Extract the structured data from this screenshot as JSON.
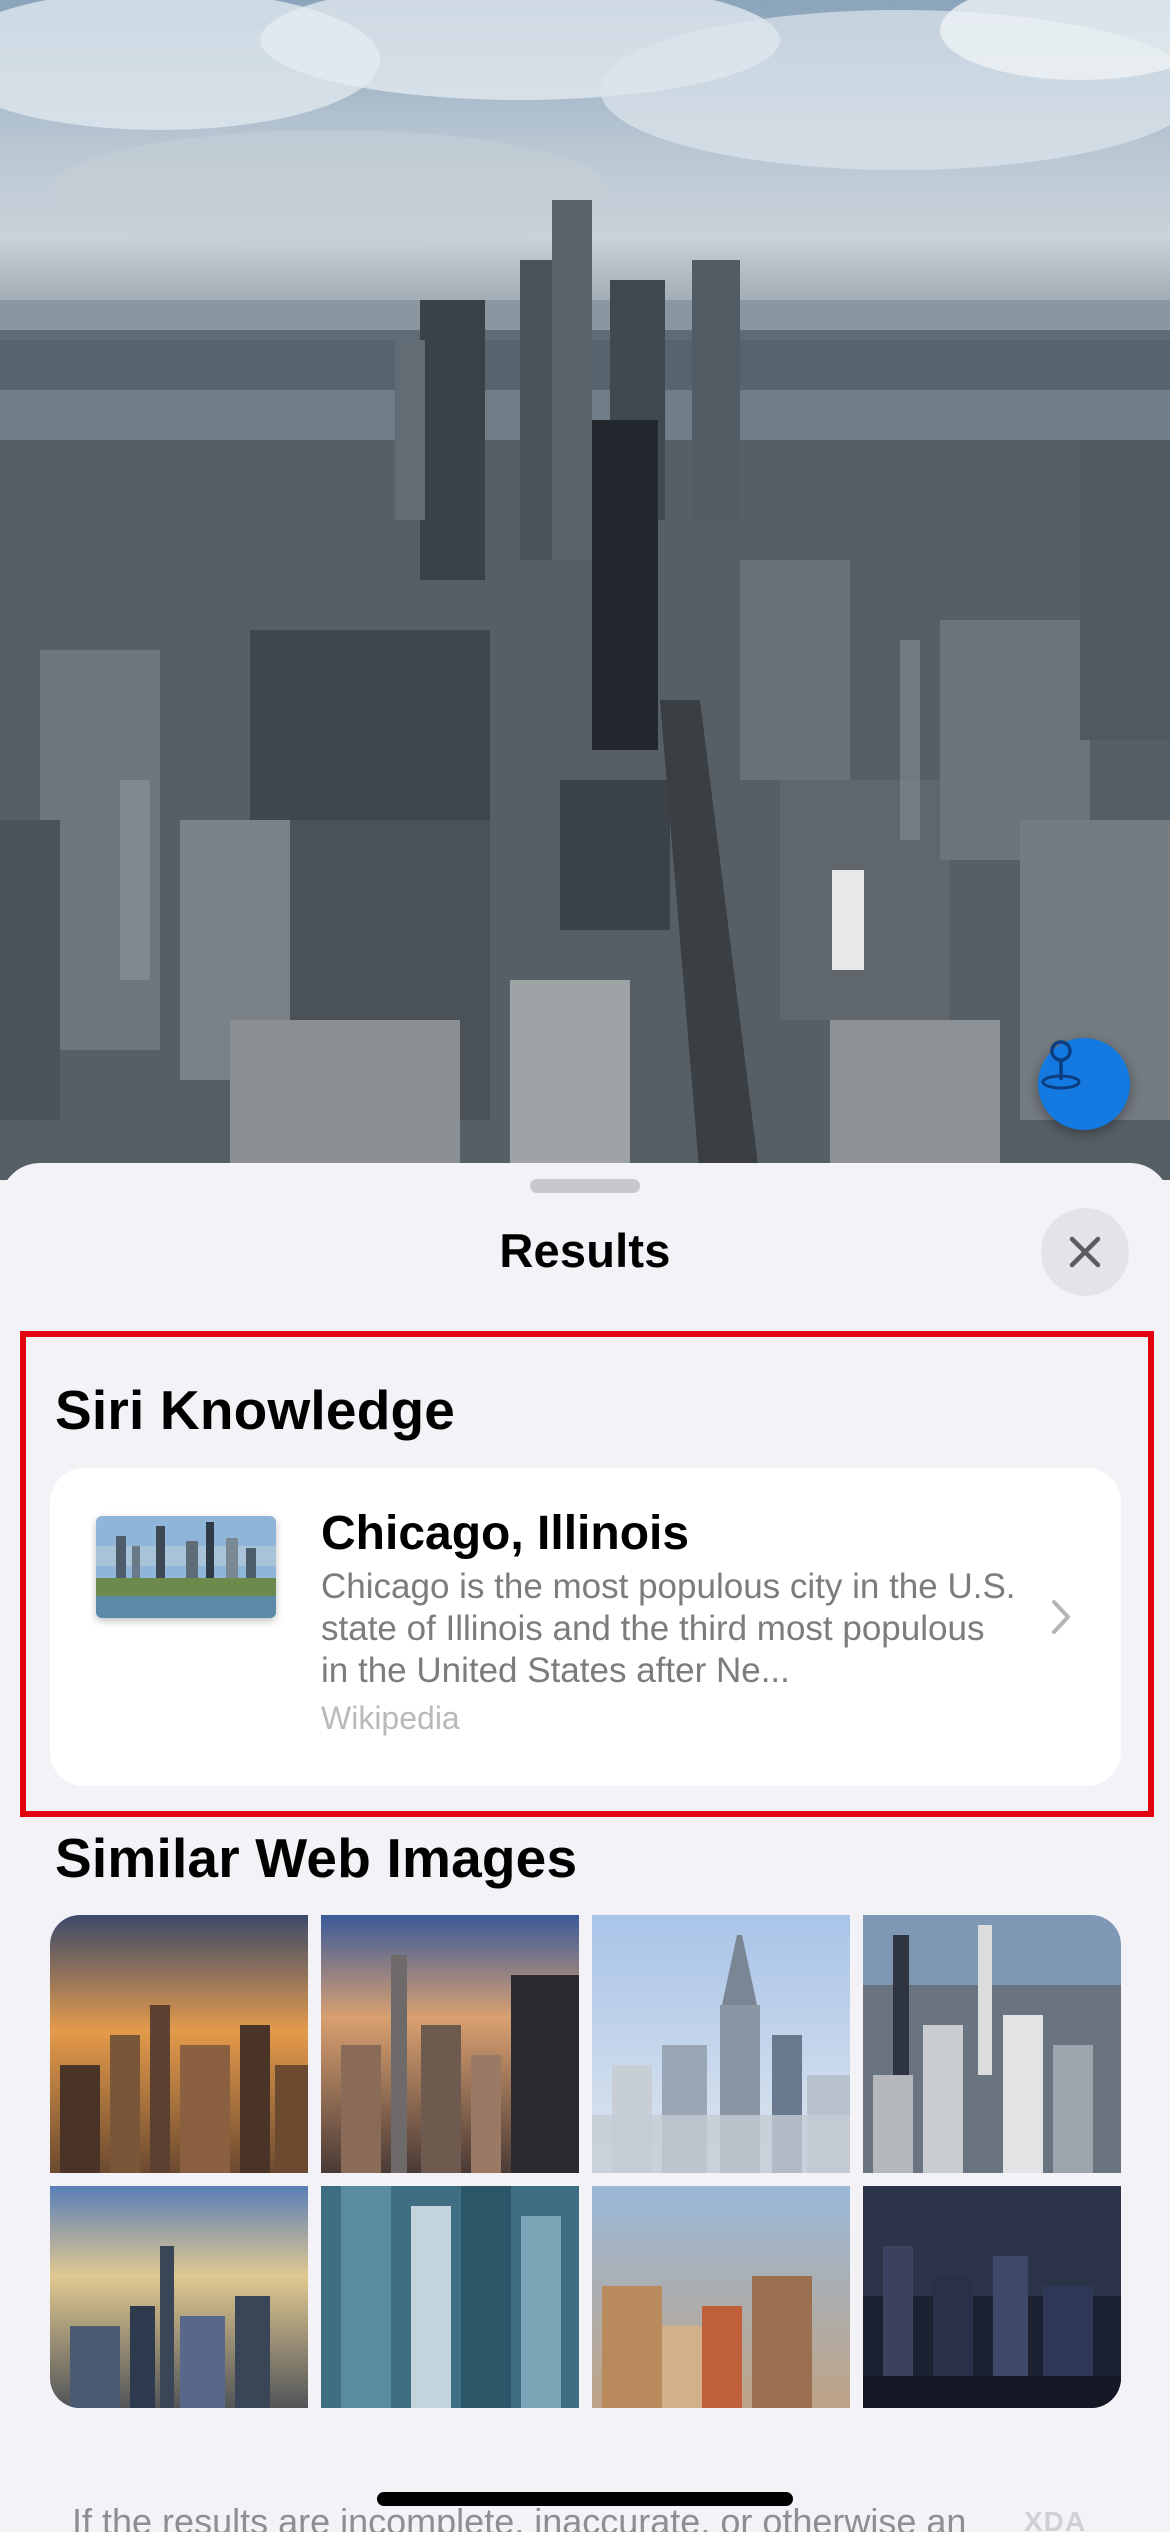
{
  "sheet": {
    "title": "Results",
    "close_icon": "close-icon"
  },
  "siri_knowledge": {
    "heading": "Siri Knowledge",
    "card": {
      "title": "Chicago, Illinois",
      "description": "Chicago is the most populous city in the U.S. state of Illinois and the third most populous in the United States after Ne...",
      "source": "Wikipedia",
      "chevron_icon": "chevron-right-icon"
    }
  },
  "similar_images": {
    "heading": "Similar Web Images",
    "count": 8
  },
  "footer": {
    "text": "If the results are incomplete, inaccurate, or otherwise an"
  },
  "watermark": "XDA",
  "colors": {
    "accent": "#1479e0",
    "highlight_border": "#e3000f",
    "sheet_background": "#f2f2f7",
    "secondary_text": "#7c7c80"
  }
}
